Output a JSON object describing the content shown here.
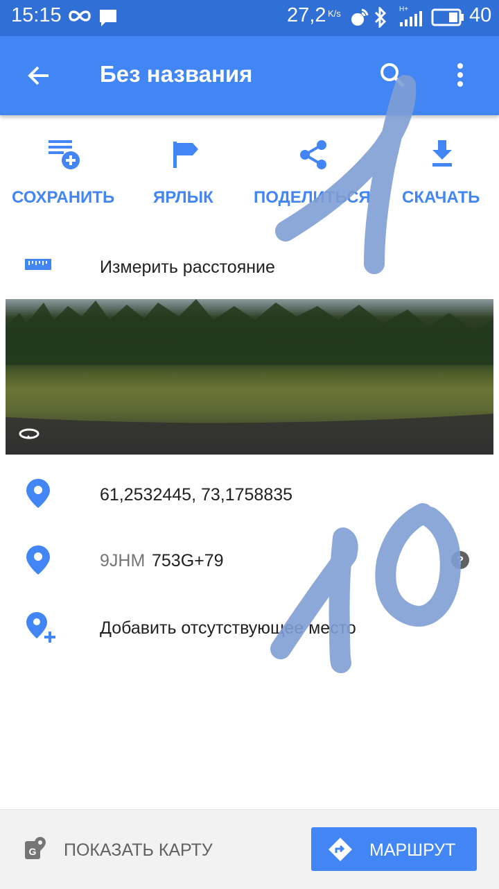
{
  "status_bar": {
    "time": "15:15",
    "speed": "27,2",
    "speed_unit": "K/s",
    "network": "H+",
    "battery": "40"
  },
  "appbar": {
    "title": "Без названия",
    "icons": [
      "arrow-back-icon",
      "search-icon",
      "more-vert-icon"
    ]
  },
  "actions": [
    {
      "label": "СОХРАНИТЬ",
      "icon": "playlist-add-icon"
    },
    {
      "label": "ЯРЛЫК",
      "icon": "flag-icon"
    },
    {
      "label": "ПОДЕЛИТЬСЯ",
      "icon": "share-icon"
    },
    {
      "label": "СКАЧАТЬ",
      "icon": "download-icon"
    }
  ],
  "measure": {
    "label": "Измерить расстояние",
    "icon": "ruler-icon"
  },
  "details": {
    "coordinates": "61,2532445, 73,1758835",
    "plus_code_area": "9JHM",
    "plus_code": "753G+79",
    "add_place": "Добавить отсутствующее место"
  },
  "annotations": {
    "handwritten_1": "1",
    "handwritten_10": "10",
    "color": "#7f9fd4"
  },
  "bottom": {
    "show_map": "ПОКАЗАТЬ КАРТУ",
    "route": "МАРШРУТ"
  },
  "colors": {
    "accent": "#4285f4",
    "status_bar": "#2f6fd6"
  }
}
